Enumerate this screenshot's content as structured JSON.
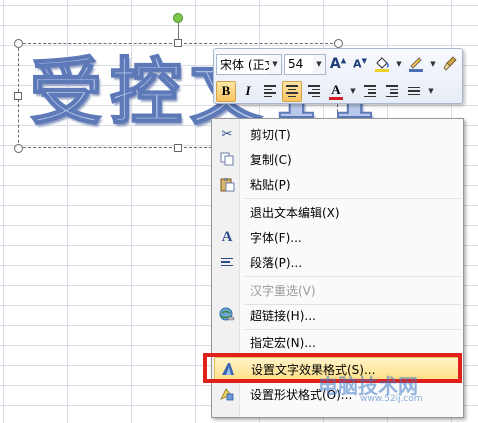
{
  "wordart": {
    "text": "受控文11"
  },
  "minibar": {
    "font_name": "宋体 (正文",
    "font_size": "54",
    "bold_label": "B",
    "italic_label": "I",
    "font_color_label": "A"
  },
  "menu": {
    "items": [
      {
        "label": "剪切(T)",
        "icon": "scissors-icon",
        "enabled": true
      },
      {
        "label": "复制(C)",
        "icon": "copy-icon",
        "enabled": true
      },
      {
        "label": "粘贴(P)",
        "icon": "paste-icon",
        "enabled": true
      },
      {
        "label": "退出文本编辑(X)",
        "icon": "",
        "enabled": true
      },
      {
        "label": "字体(F)...",
        "icon": "font-icon",
        "enabled": true
      },
      {
        "label": "段落(P)...",
        "icon": "paragraph-icon",
        "enabled": true
      },
      {
        "label": "汉字重选(V)",
        "icon": "",
        "enabled": false
      },
      {
        "label": "超链接(H)...",
        "icon": "hyperlink-icon",
        "enabled": true
      },
      {
        "label": "指定宏(N)...",
        "icon": "",
        "enabled": true
      },
      {
        "label": "设置文字效果格式(S)...",
        "icon": "text-effects-icon",
        "enabled": true,
        "highlighted": true
      },
      {
        "label": "设置形状格式(O)...",
        "icon": "shape-format-icon",
        "enabled": true
      }
    ]
  },
  "watermark": {
    "brand": "电脑技术网",
    "url": "www.52ij.com"
  },
  "colors": {
    "highlight": "#fedf86",
    "annotation_box": "#e0201b",
    "font_color_bar": "#d42020",
    "fill_color_bar": "#e8d22a"
  }
}
